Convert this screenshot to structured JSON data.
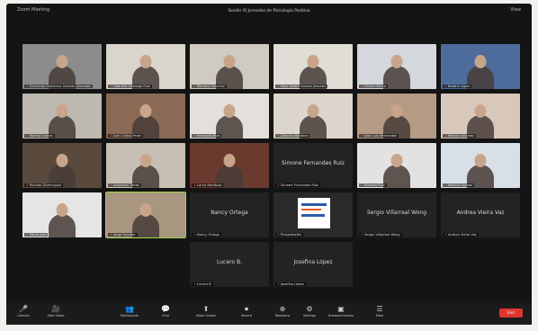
{
  "window": {
    "left_text": "Zoom Meeting",
    "title": "Sesión XI Jornadas de Psicología Positiva",
    "right_text": "View"
  },
  "colors": {
    "background": "#141414",
    "tile": "#2a2a2a",
    "active_speaker": "#9bd34a",
    "end": "#e0342f"
  },
  "participants": [
    {
      "label": "Edmundo Guillermo Galindo Alvarado",
      "type": "video",
      "tone": "#8c8c8c"
    },
    {
      "label": "Gabriela Santiago Ruiz",
      "type": "video",
      "tone": "#d9d4cc"
    },
    {
      "label": "Mariano Sanchez",
      "type": "video",
      "tone": "#cfcac2"
    },
    {
      "label": "Nora Isabel Cuevas Jimenez",
      "type": "video",
      "tone": "#e0dcd6"
    },
    {
      "label": "Carlos Garcia",
      "type": "video",
      "tone": "#d4d8dc"
    },
    {
      "label": "Beatriz Lopez",
      "type": "video",
      "tone": "#4d6c9c"
    },
    {
      "label": "Marisol Garcia",
      "type": "video",
      "tone": "#bdb8b0"
    },
    {
      "label": "Juan Carlos Perez",
      "type": "video",
      "tone": "#8a6a55"
    },
    {
      "label": "Fernanda Rios",
      "type": "video",
      "tone": "#e3e0db"
    },
    {
      "label": "Daniela Martinez",
      "type": "video",
      "tone": "#dcd5cb"
    },
    {
      "label": "Jose Luis Hernandez",
      "type": "video",
      "tone": "#b59a84"
    },
    {
      "label": "Monica Sanchez",
      "type": "video",
      "tone": "#d8c8bc"
    },
    {
      "label": "Ricardo Dominguez",
      "type": "video",
      "tone": "#5a4a3e"
    },
    {
      "label": "Alejandra Torres",
      "type": "video",
      "tone": "#c7bfb3"
    },
    {
      "label": "Laura Mendoza",
      "type": "video",
      "tone": "#6a3a2e"
    },
    {
      "label": "Simone Fernandes Ruiz",
      "type": "name",
      "center": "Simone Fernandes Ruiz"
    },
    {
      "label": "Roberto Ruiz",
      "type": "video",
      "tone": "#e2e2e2"
    },
    {
      "label": "Patricia Gomez",
      "type": "video",
      "tone": "#d9dfe6"
    },
    {
      "label": "Maria Jose",
      "type": "video",
      "tone": "#e5e5e5"
    },
    {
      "label": "Jorge Escobar",
      "type": "video",
      "tone": "#a99680",
      "active": true
    },
    {
      "label": "Nancy Ortega",
      "type": "name",
      "center": "Nancy Ortega"
    },
    {
      "label": "Presentación",
      "type": "logo"
    },
    {
      "label": "Sergio Villarreal Wong",
      "type": "name",
      "center": "Sergio Villarreal Wong"
    },
    {
      "label": "Andrea Vieira Vaz",
      "type": "name",
      "center": "Andrea Vieira Vaz"
    },
    {
      "label": "Lucero B",
      "type": "name",
      "center": "Lucero B."
    },
    {
      "label": "Josefina López",
      "type": "name",
      "center": "Josefina López"
    }
  ],
  "toolbar": {
    "items": [
      {
        "glyph": "🎤",
        "label": "Unmute",
        "icon": "mic-icon"
      },
      {
        "glyph": "🎥",
        "label": "Start Video",
        "icon": "camera-icon"
      },
      {
        "glyph": "👥",
        "label": "Participants",
        "icon": "participants-icon"
      },
      {
        "glyph": "💬",
        "label": "Chat",
        "icon": "chat-icon"
      },
      {
        "glyph": "⬆",
        "label": "Share Screen",
        "icon": "share-icon"
      },
      {
        "glyph": "⏺",
        "label": "Record",
        "icon": "record-icon"
      },
      {
        "glyph": "⊕",
        "label": "Reactions",
        "icon": "reactions-icon"
      },
      {
        "glyph": "⚙",
        "label": "Settings",
        "icon": "settings-icon"
      },
      {
        "glyph": "▣",
        "label": "Breakout Rooms",
        "icon": "breakout-icon"
      },
      {
        "glyph": "☰",
        "label": "More",
        "icon": "more-icon"
      }
    ],
    "end_label": "End"
  }
}
